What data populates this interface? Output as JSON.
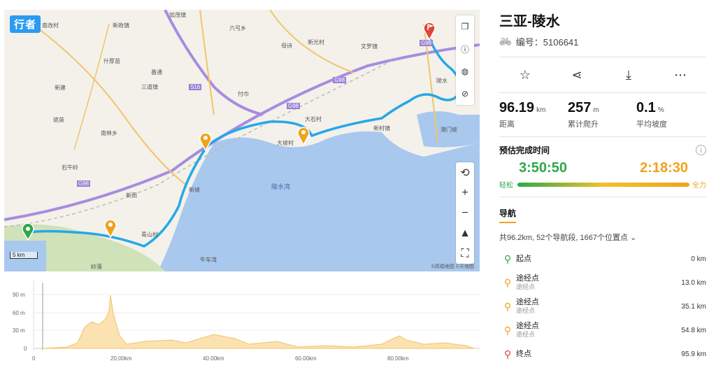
{
  "map": {
    "logo": "行者",
    "places": [
      "南改村",
      "加茂镇",
      "新政镇",
      "六弓乡",
      "什厚苗",
      "番通",
      "母诗",
      "新光村",
      "文罗镇",
      "新建",
      "三道镇",
      "付巾",
      "遮英",
      "南林乡",
      "大石村",
      "大坡村",
      "新村镇",
      "石牛岭",
      "新田",
      "新坡",
      "港门坡",
      "牛车湾",
      "青山村",
      "岭落",
      "陵水"
    ],
    "sea_label": "陵水湾",
    "roads": [
      "G98",
      "S16",
      "G98",
      "G98",
      "G98"
    ],
    "scale": "5 km",
    "copyright": "©高德地图  ©天地图",
    "tools": [
      "copy-icon",
      "info-icon",
      "globe-icon",
      "layer-icon"
    ],
    "zoom": [
      "⟲",
      "+",
      "−",
      "▲"
    ],
    "fullscreen": "⛶"
  },
  "elevation": {
    "y_ticks": [
      "90 m",
      "60 m",
      "30 m",
      "0"
    ],
    "x_ticks": [
      "0",
      "20.00km",
      "40.00km",
      "60.00km",
      "80.00km"
    ]
  },
  "route": {
    "title": "三亚-陵水",
    "id_label": "编号：5106641",
    "actions": [
      "star-icon",
      "share-icon",
      "download-icon",
      "more-icon"
    ],
    "stats": [
      {
        "value": "96.19",
        "unit": "km",
        "label": "距离"
      },
      {
        "value": "257",
        "unit": "m",
        "label": "累计爬升"
      },
      {
        "value": "0.1",
        "unit": "%",
        "label": "平均坡度"
      }
    ],
    "estimate_title": "预估完成时间",
    "time_easy": "3:50:50",
    "time_hard": "2:18:30",
    "easy_label": "轻松",
    "hard_label": "全力",
    "nav_tab": "导航",
    "nav_summary": "共96.2km, 52个导航段, 1667个位置点 ⌄",
    "waypoints": [
      {
        "name": "起点",
        "sub": "",
        "dist": "0 km",
        "color": "#2ea84a"
      },
      {
        "name": "途经点",
        "sub": "途经点",
        "dist": "13.0 km",
        "color": "#f0a21c"
      },
      {
        "name": "途经点",
        "sub": "途经点",
        "dist": "35.1 km",
        "color": "#f0a21c"
      },
      {
        "name": "途经点",
        "sub": "途经点",
        "dist": "54.8 km",
        "color": "#f0a21c"
      },
      {
        "name": "终点",
        "sub": "",
        "dist": "95.9 km",
        "color": "#e0453a"
      }
    ]
  }
}
